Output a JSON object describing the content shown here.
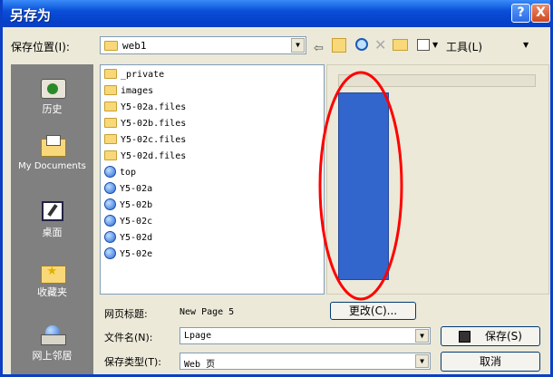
{
  "window": {
    "title": "另存为",
    "help_glyph": "?",
    "close_glyph": "X"
  },
  "location": {
    "label": "保存位置(I):",
    "value": "web1"
  },
  "toolbar": {
    "tools_label": "工具(L)"
  },
  "places": [
    {
      "label": "历史",
      "icon": "history-icon"
    },
    {
      "label": "My Documents",
      "icon": "my-documents-icon"
    },
    {
      "label": "桌面",
      "icon": "desktop-icon"
    },
    {
      "label": "收藏夹",
      "icon": "favorites-icon"
    },
    {
      "label": "网上邻居",
      "icon": "network-icon"
    }
  ],
  "files": [
    {
      "name": "_private",
      "type": "folder"
    },
    {
      "name": "images",
      "type": "folder"
    },
    {
      "name": "Y5-02a.files",
      "type": "folder"
    },
    {
      "name": "Y5-02b.files",
      "type": "folder"
    },
    {
      "name": "Y5-02c.files",
      "type": "folder"
    },
    {
      "name": "Y5-02d.files",
      "type": "folder"
    },
    {
      "name": "top",
      "type": "web"
    },
    {
      "name": "Y5-02a",
      "type": "web"
    },
    {
      "name": "Y5-02b",
      "type": "web"
    },
    {
      "name": "Y5-02c",
      "type": "web"
    },
    {
      "name": "Y5-02d",
      "type": "web"
    },
    {
      "name": "Y5-02e",
      "type": "web"
    }
  ],
  "page_title": {
    "label": "网页标题:",
    "value": "New Page 5",
    "change_button": "更改(C)..."
  },
  "filename": {
    "label": "文件名(N):",
    "value": "Lpage"
  },
  "filetype": {
    "label": "保存类型(T):",
    "value": "Web 页"
  },
  "buttons": {
    "save": "保存(S)",
    "cancel": "取消"
  },
  "colors": {
    "title_bar": "#0a4fd8",
    "places_bar": "#808080",
    "preview_fill": "#3366cc",
    "annotation": "#ff0000"
  }
}
